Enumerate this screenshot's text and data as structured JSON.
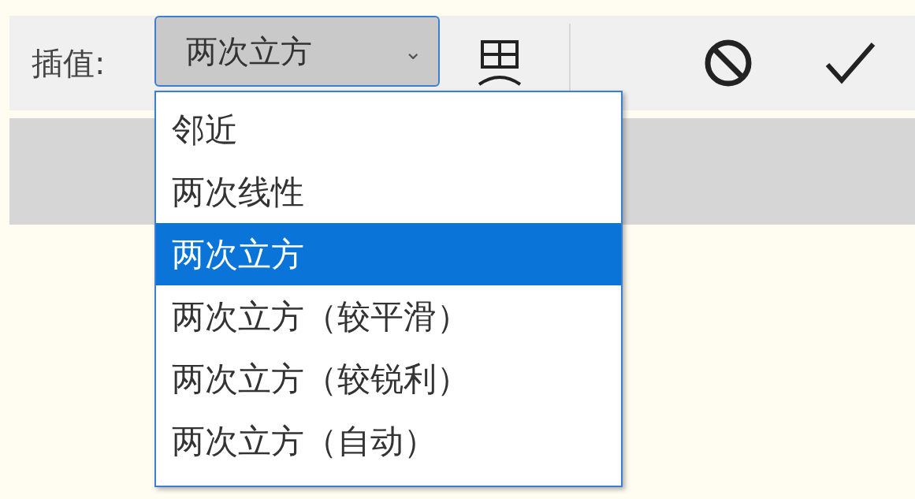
{
  "toolbar": {
    "label": "插值:",
    "select": {
      "value": "两次立方",
      "caret": "⌄"
    },
    "actions": [
      {
        "kind": "cancel"
      },
      {
        "kind": "commit"
      }
    ]
  },
  "menu": {
    "items": [
      {
        "label": "邻近",
        "selected": false
      },
      {
        "label": "两次线性",
        "selected": false
      },
      {
        "label": "两次立方",
        "selected": true
      },
      {
        "label": "两次立方（较平滑）",
        "selected": false
      },
      {
        "label": "两次立方（较锐利）",
        "selected": false
      },
      {
        "label": "两次立方（自动）",
        "selected": false
      }
    ]
  }
}
